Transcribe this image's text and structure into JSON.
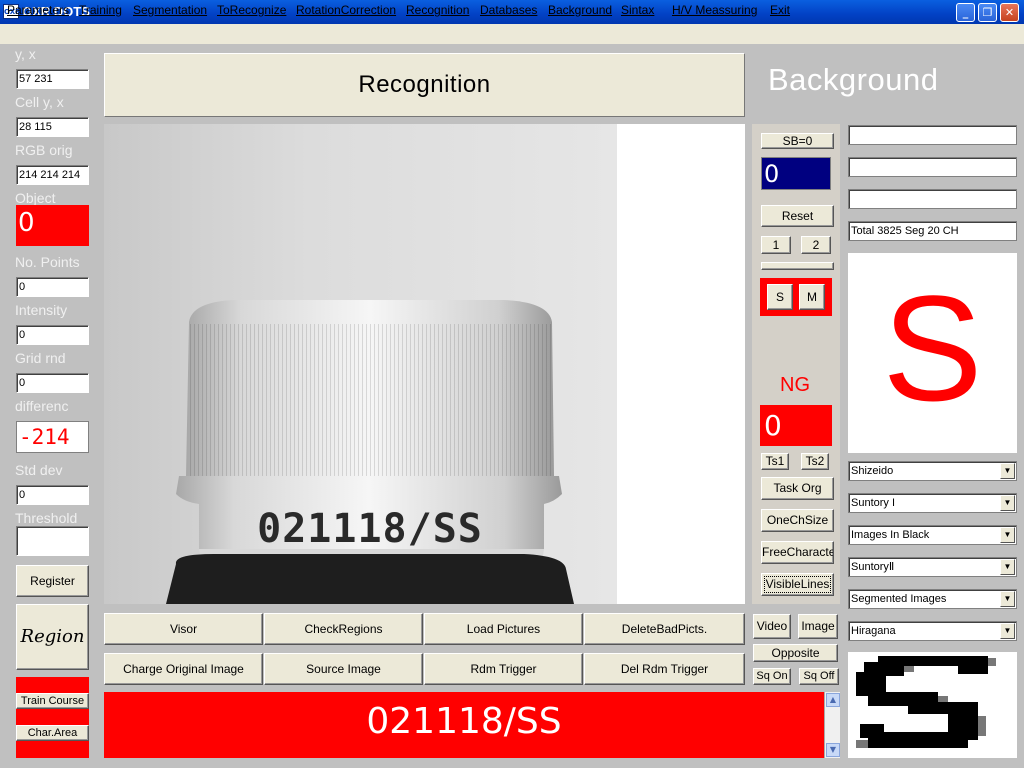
{
  "window": {
    "title": "OXR DOTS",
    "icon_text": "OXR"
  },
  "menu": [
    "Parameters",
    "Training",
    "Segmentation",
    "ToRecognize",
    "RotationCorrection",
    "Recognition",
    "Databases",
    "Background",
    "Sintax",
    "H/V Meassuring",
    "Exit"
  ],
  "left": {
    "yx_label": "y, x",
    "yx_value": "57 231",
    "cell_label": "Cell y, x",
    "cell_value": "28 115",
    "rgb_label": "RGB orig",
    "rgb_value": "214 214 214",
    "object_label": "Object",
    "object_value": "0",
    "points_label": "No. Points",
    "points_value": "0",
    "intensity_label": "Intensity",
    "intensity_value": "0",
    "grid_label": "Grid rnd",
    "grid_value": "0",
    "diff_label": "differenc",
    "diff_value": "-214",
    "std_label": "Std dev",
    "std_value": "0",
    "threshold_label": "Threshold",
    "threshold_value": "",
    "register_label": "Register",
    "region_label": "Region",
    "train_course_label": "Train Course",
    "char_area_label": "Char.Area"
  },
  "header": {
    "recognition_title": "Recognition",
    "background_title": "Background"
  },
  "photo": {
    "printed_code": "021118/SS"
  },
  "middle": {
    "sb_label": "SB=0",
    "counter_value": "0",
    "reset_label": "Reset",
    "btn1_label": "1",
    "btn2_label": "2",
    "s_label": "S",
    "m_label": "M",
    "ng_label": "NG",
    "ng_value": "0",
    "ts1_label": "Ts1",
    "ts2_label": "Ts2",
    "task_org_label": "Task Org",
    "one_ch_size_label": "OneChSize",
    "free_character_label": "FreeCharacter",
    "visible_lines_label": "VisibleLines",
    "video_label": "Video",
    "image_label": "Image",
    "opposite_label": "Opposite",
    "sq_on_label": "Sq On",
    "sq_off_label": "Sq Off"
  },
  "right": {
    "field1": "",
    "field2": "",
    "field3": "",
    "total_text": "Total 3825  Seg 20  CH",
    "recognized_char": "S",
    "combos": [
      "Shizeido",
      "Suntory I",
      "Images In Black",
      "SuntoryⅡ",
      "Segmented Images",
      "Hiragana"
    ]
  },
  "bottom_buttons": {
    "visor": "Visor",
    "check_regions": "CheckRegions",
    "load_pictures": "Load Pictures",
    "delete_bad": "DeleteBadPicts.",
    "charge_original": "Charge Original Image",
    "source_image": "Source Image",
    "rdm_trigger": "Rdm Trigger",
    "del_rdm_trigger": "Del Rdm Trigger"
  },
  "result": {
    "text": "021118/SS"
  },
  "colors": {
    "red": "#ff0000",
    "navy": "#000080",
    "face": "#ece9d8",
    "panel": "#c0c0c0"
  },
  "icons": {
    "minimize": "minimize-icon",
    "restore": "restore-icon",
    "close": "close-icon",
    "scroll_up": "scroll-up-arrow-icon",
    "scroll_down": "scroll-down-arrow-icon",
    "dropdown": "dropdown-arrow-icon"
  }
}
